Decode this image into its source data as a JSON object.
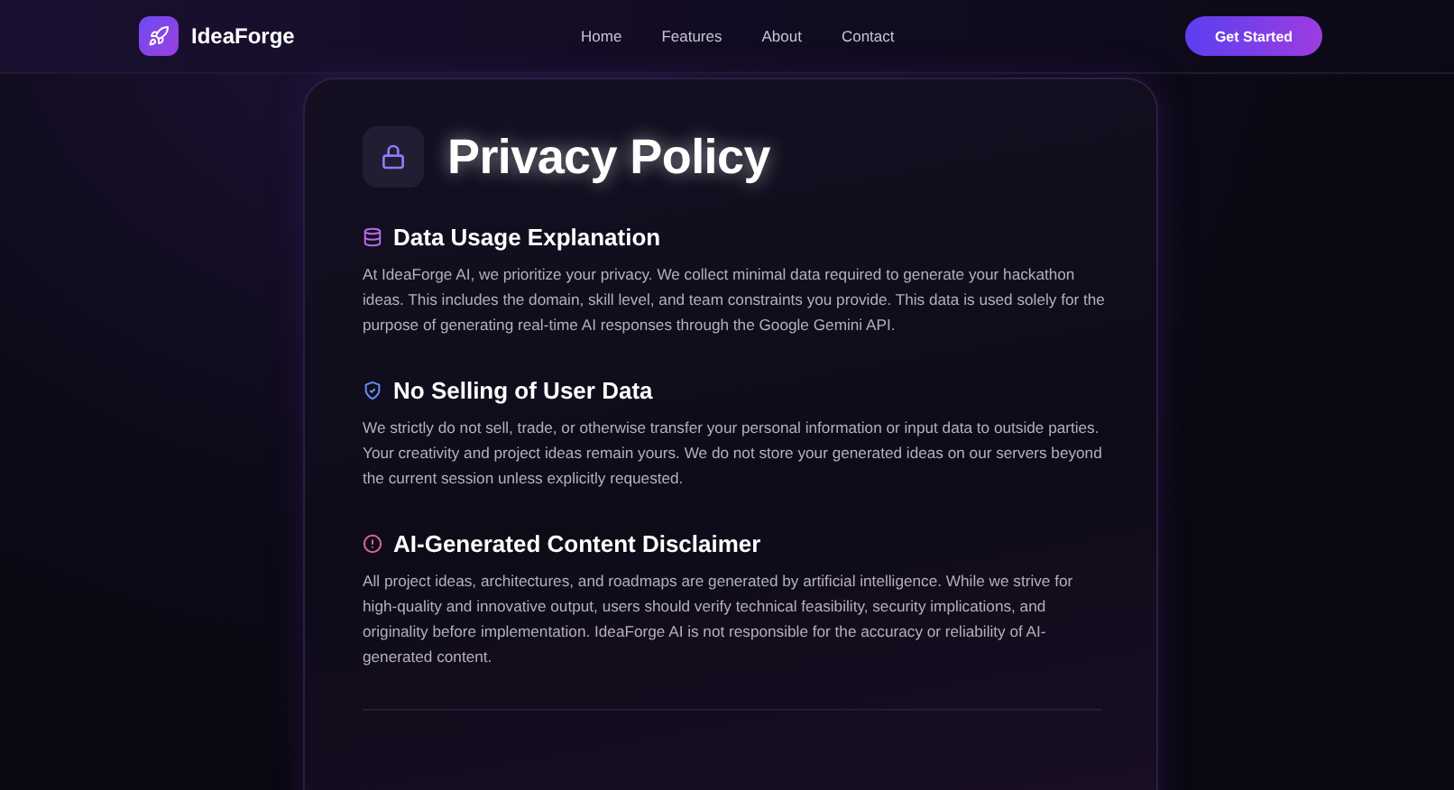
{
  "brand": {
    "name": "IdeaForge"
  },
  "nav": {
    "links": [
      "Home",
      "Features",
      "About",
      "Contact"
    ],
    "cta": "Get Started"
  },
  "page": {
    "title": "Privacy Policy"
  },
  "sections": [
    {
      "kind": "database",
      "heading": "Data Usage Explanation",
      "body": "At IdeaForge AI, we prioritize your privacy. We collect minimal data required to generate your hackathon ideas. This includes the domain, skill level, and team constraints you provide. This data is used solely for the purpose of generating real-time AI responses through the Google Gemini API."
    },
    {
      "kind": "shield",
      "heading": "No Selling of User Data",
      "body": "We strictly do not sell, trade, or otherwise transfer your personal information or input data to outside parties. Your creativity and project ideas remain yours. We do not store your generated ideas on our servers beyond the current session unless explicitly requested."
    },
    {
      "kind": "alert",
      "heading": "AI-Generated Content Disclaimer",
      "body": "All project ideas, architectures, and roadmaps are generated by artificial intelligence. While we strive for high-quality and innovative output, users should verify technical feasibility, security implications, and originality before implementation. IdeaForge AI is not responsible for the accuracy or reliability of AI-generated content."
    }
  ]
}
